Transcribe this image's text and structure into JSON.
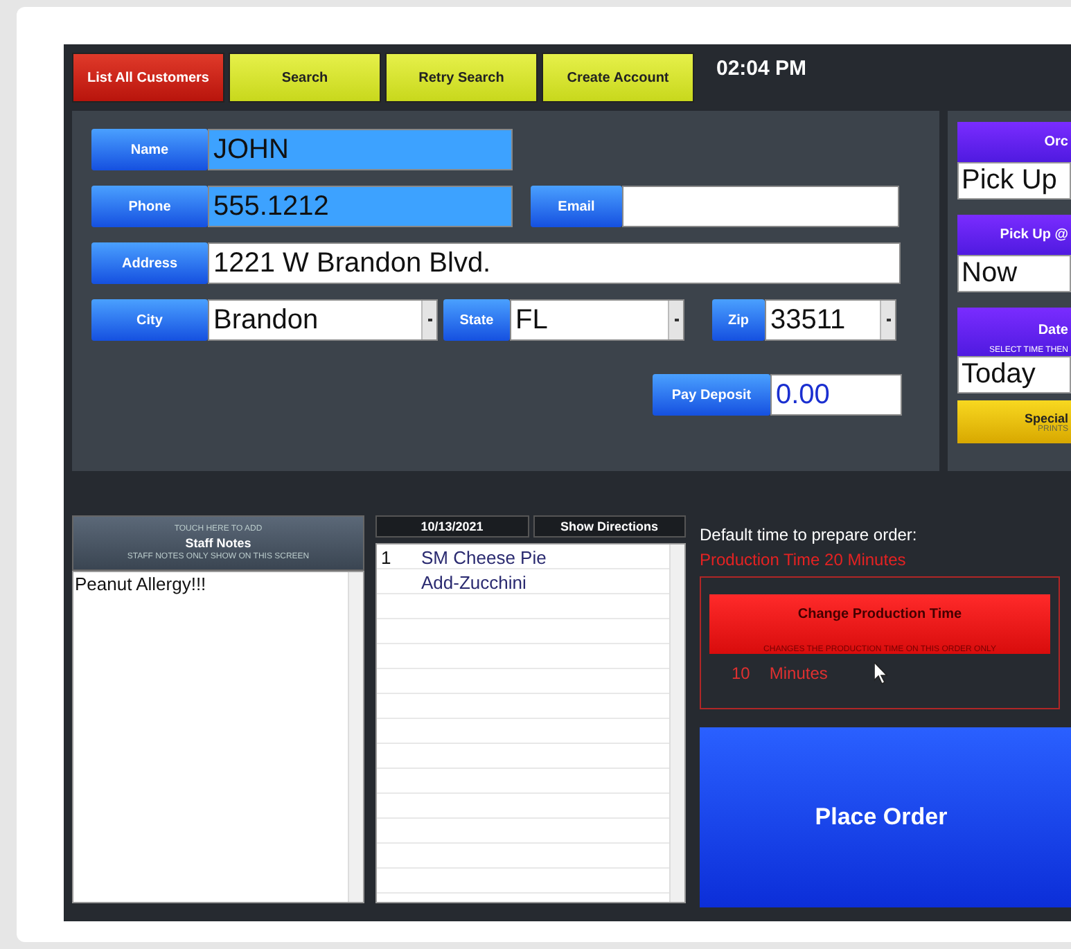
{
  "toolbar": [
    {
      "label": "List All Customers",
      "kind": "danger"
    },
    {
      "label": "Search",
      "kind": "action"
    },
    {
      "label": "Retry Search",
      "kind": "action"
    },
    {
      "label": "Create Account",
      "kind": "action"
    }
  ],
  "clock": "02:04 PM",
  "customer": {
    "name": {
      "label": "Name",
      "value": "JOHN"
    },
    "phone": {
      "label": "Phone",
      "value": "555.1212"
    },
    "email": {
      "label": "Email"
    },
    "address": {
      "label": "Address",
      "value": "1221 W Brandon Blvd."
    },
    "city": {
      "label": "City",
      "value": "Brandon"
    },
    "state": {
      "label": "State",
      "value": "FL"
    },
    "zip": {
      "label": "Zip",
      "value": "33511"
    },
    "deposit": {
      "label": "Pay Deposit",
      "value": "0.00"
    }
  },
  "order_options": [
    {
      "heading": "Orc",
      "value": "Pick Up"
    },
    {
      "heading": "Pick Up @",
      "value": "Now"
    },
    {
      "heading": "Date",
      "hint": "SELECT TIME THEN",
      "value": "Today"
    }
  ],
  "special": {
    "label": "Special",
    "hint": "PRINTS"
  },
  "staff_notes": {
    "hint_top": "TOUCH HERE TO ADD",
    "title": "Staff Notes",
    "hint_bottom": "STAFF NOTES ONLY SHOW ON THIS SCREEN",
    "text": "Peanut Allergy!!!"
  },
  "order": {
    "date": "10/13/2021",
    "directions_button": "Show Directions",
    "items": [
      {
        "qty": "1",
        "name": "SM Cheese Pie"
      },
      {
        "name": "Add-Zucchini"
      }
    ]
  },
  "production": {
    "caption": "Default time to prepare order:",
    "default_time": "Production Time 20 Minutes",
    "button": {
      "label": "Change Production Time",
      "hint": "CHANGES THE PRODUCTION TIME ON THIS ORDER ONLY"
    },
    "value": "10",
    "unit": "Minutes"
  },
  "place_order": "Place Order"
}
